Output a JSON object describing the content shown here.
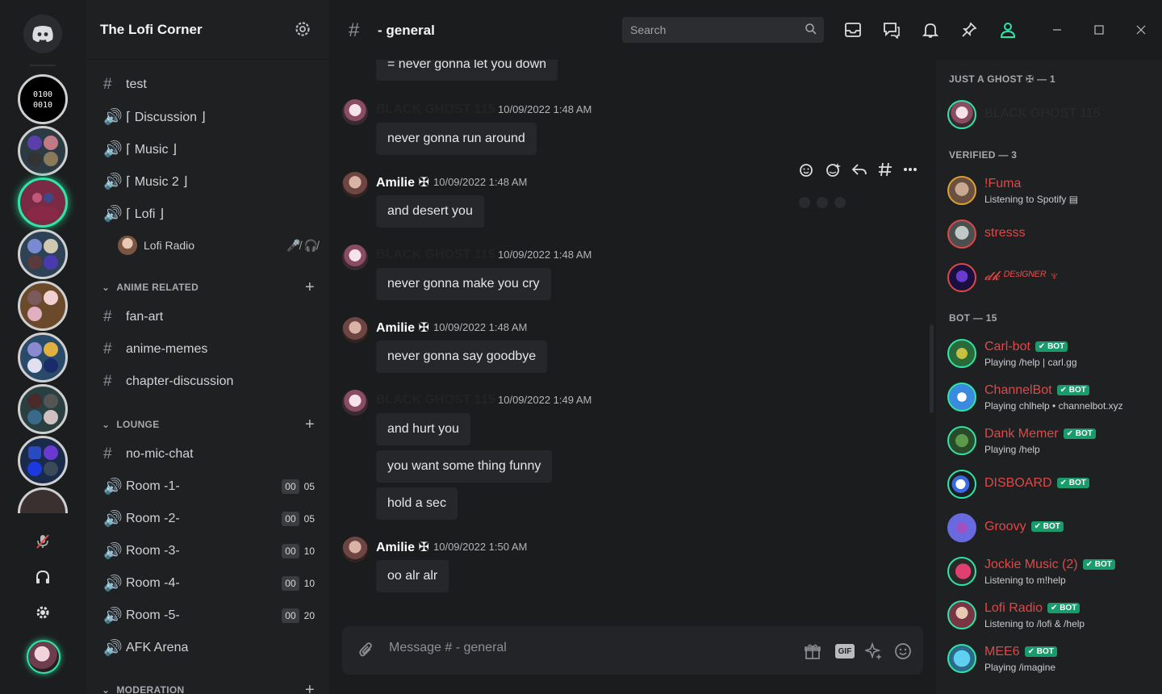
{
  "server": {
    "name": "The Lofi Corner"
  },
  "channels": {
    "top": [
      {
        "type": "text",
        "name": "test"
      },
      {
        "type": "voice",
        "name": "⌈ Discussion ⌋"
      },
      {
        "type": "voice",
        "name": "⌈ Music ⌋"
      },
      {
        "type": "voice",
        "name": "⌈ Music 2 ⌋"
      },
      {
        "type": "voice",
        "name": "⌈ Lofi ⌋"
      }
    ],
    "voice_user": {
      "name": "Lofi Radio"
    },
    "anime_related": {
      "label": "ANIME RELATED",
      "items": [
        "fan-art",
        "anime-memes",
        "chapter-discussion"
      ]
    },
    "lounge": {
      "label": "LOUNGE",
      "items": [
        {
          "type": "text",
          "name": "no-mic-chat"
        },
        {
          "type": "voice",
          "name": "Room -1-",
          "timer": [
            "00",
            "05"
          ]
        },
        {
          "type": "voice",
          "name": "Room -2-",
          "timer": [
            "00",
            "05"
          ]
        },
        {
          "type": "voice",
          "name": "Room -3-",
          "timer": [
            "00",
            "10"
          ]
        },
        {
          "type": "voice",
          "name": "Room -4-",
          "timer": [
            "00",
            "10"
          ]
        },
        {
          "type": "voice",
          "name": "Room -5-",
          "timer": [
            "00",
            "20"
          ]
        },
        {
          "type": "voice",
          "name": "AFK Arena"
        }
      ]
    },
    "moderation": {
      "label": "MODERATION"
    }
  },
  "topbar": {
    "channel_title": "- general",
    "search_placeholder": "Search"
  },
  "messages": [
    {
      "text": "= never gonna let you down"
    },
    {
      "author": "BLACK GHOST 115",
      "time": "10/09/2022 1:48 AM",
      "text": "never gonna run around"
    },
    {
      "author": "Amilie ✠",
      "time": "10/09/2022 1:48 AM",
      "text": "and desert you"
    },
    {
      "author": "BLACK GHOST 115",
      "time": "10/09/2022 1:48 AM",
      "text": "never gonna make you cry"
    },
    {
      "author": "Amilie ✠",
      "time": "10/09/2022 1:48 AM",
      "text": "never gonna say goodbye"
    },
    {
      "author": "BLACK GHOST 115",
      "time": "10/09/2022 1:49 AM",
      "texts": [
        "and hurt you",
        "you want some thing funny",
        "hold a sec"
      ]
    },
    {
      "author": "Amilie ✠",
      "time": "10/09/2022 1:50 AM",
      "text": "oo alr alr"
    }
  ],
  "composer": {
    "placeholder": "Message # - general",
    "gif_label": "GIF"
  },
  "members": {
    "ghost_group": "JUST A GHOST ✠ — 1",
    "ghost_member": "BLACK GHOST 115",
    "verified_group": "VERIFIED — 3",
    "verified": [
      {
        "name": "!Fuma",
        "activity": "Listening to Spotify ▤"
      },
      {
        "name": "stresss",
        "activity": ""
      },
      {
        "name": "𝓭𝓴 ᴰᴱˢᴵᴳᴺᴱᴿ ♆",
        "activity": ""
      }
    ],
    "bot_group": "BOT — 15",
    "bot_badge": "✔ BOT",
    "bots": [
      {
        "name": "Carl-bot",
        "activity": "Playing /help | carl.gg"
      },
      {
        "name": "ChannelBot",
        "activity": "Playing chlhelp • channelbot.xyz"
      },
      {
        "name": "Dank Memer",
        "activity": "Playing /help"
      },
      {
        "name": "DISBOARD",
        "activity": ""
      },
      {
        "name": "Groovy",
        "activity": ""
      },
      {
        "name": "Jockie Music (2)",
        "activity": "Listening to m!help"
      },
      {
        "name": "Lofi Radio",
        "activity": "Listening to /lofi & /help"
      },
      {
        "name": "MEE6",
        "activity": "Playing /imagine"
      }
    ]
  },
  "colors": {
    "accent": "#2ee6a6",
    "member_name": "#e04848",
    "bot_badge": "#1a9b6b"
  }
}
